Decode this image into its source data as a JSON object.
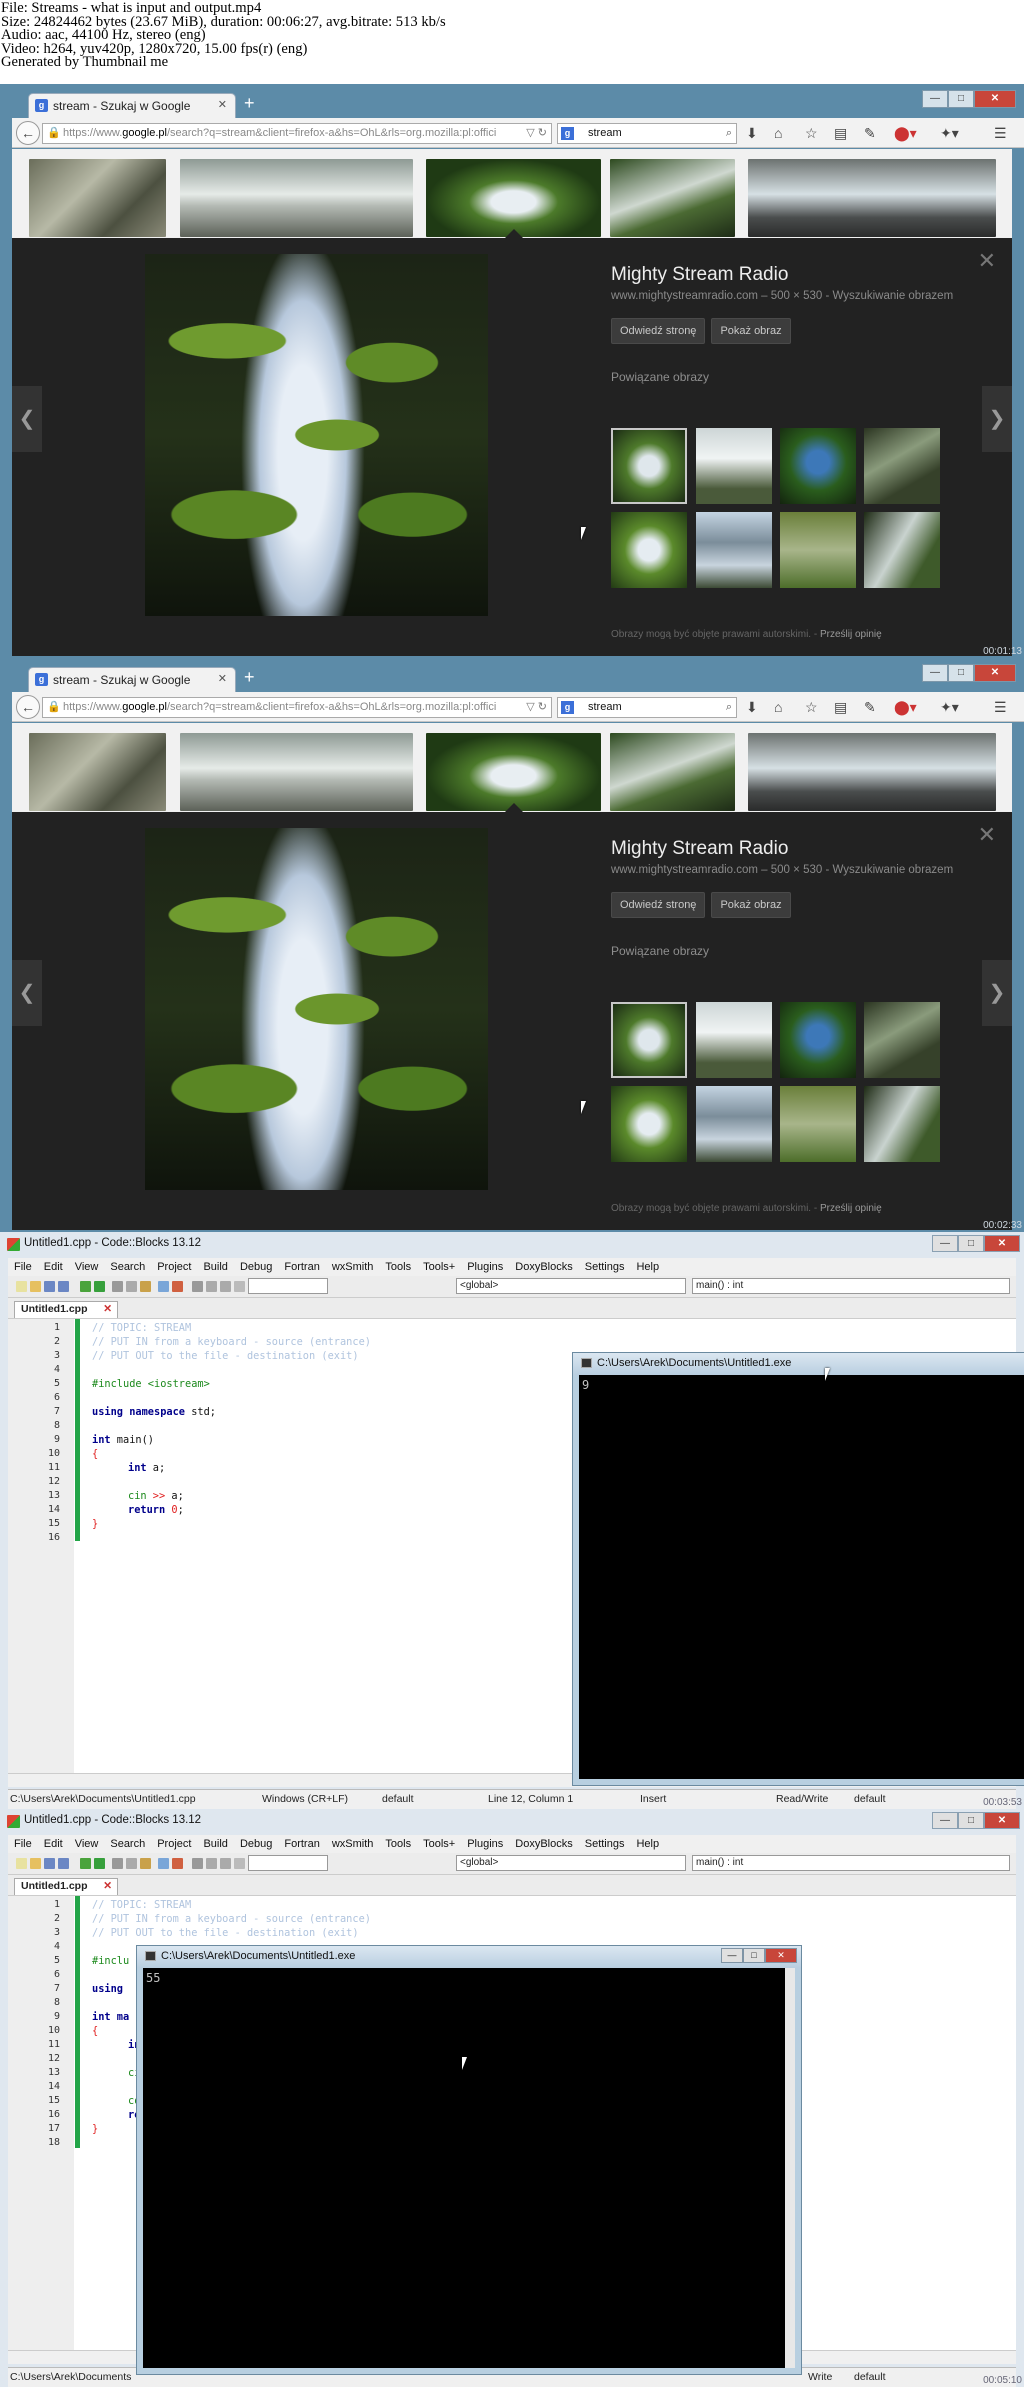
{
  "header": {
    "lines": [
      "File: Streams - what is input and output.mp4",
      "Size: 24824462 bytes (23.67 MiB), duration: 00:06:27, avg.bitrate: 513 kb/s",
      "Audio: aac, 44100 Hz, stereo (eng)",
      "Video: h264, yuv420p, 1280x720, 15.00 fps(r) (eng)",
      "Generated by Thumbnail me"
    ]
  },
  "frames": {
    "f1": {
      "timestamp": "00:01:13"
    },
    "f2": {
      "timestamp": "00:02:33"
    },
    "f3": {
      "timestamp": "00:03:53"
    },
    "f4": {
      "timestamp": "00:05:10"
    }
  },
  "browser": {
    "tab_title": "stream - Szukaj w Google",
    "url_prefix": "https://www.",
    "url_host": "google.pl",
    "url_rest": "/search?q=stream&client=firefox-a&hs=OhL&rls=org.mozilla:pl:offici",
    "search_value": "stream",
    "image_title": "Mighty Stream Radio",
    "image_meta": "www.mightystreamradio.com – 500 × 530 - Wyszukiwanie obrazem",
    "visit_page_btn": "Odwiedź stronę",
    "view_image_btn": "Pokaż obraz",
    "related_label": "Powiązane obrazy",
    "copyright_note": "Obrazy mogą być objęte prawami autorskimi.",
    "feedback_link": "Prześlij opinię"
  },
  "codeblocks": {
    "title": "Untitled1.cpp - Code::Blocks 13.12",
    "menu": [
      "File",
      "Edit",
      "View",
      "Search",
      "Project",
      "Build",
      "Debug",
      "Fortran",
      "wxSmith",
      "Tools",
      "Tools+",
      "Plugins",
      "DoxyBlocks",
      "Settings",
      "Help"
    ],
    "scope_combo": "<global>",
    "func_combo": "main() : int",
    "file_tab": "Untitled1.cpp",
    "line_numbers_a": [
      "1",
      "2",
      "3",
      "4",
      "5",
      "6",
      "7",
      "8",
      "9",
      "10",
      "11",
      "12",
      "13",
      "14",
      "15",
      "16"
    ],
    "line_numbers_b": [
      "1",
      "2",
      "3",
      "4",
      "5",
      "6",
      "7",
      "8",
      "9",
      "10",
      "11",
      "12",
      "13",
      "14",
      "15",
      "16",
      "17",
      "18"
    ],
    "code": {
      "c1": "// TOPIC: STREAM",
      "c2": "// PUT IN from a keyboard - source (entrance)",
      "c3": "// PUT OUT to the file - destination (exit)",
      "include": "#include <iostream>",
      "using_kw": "using namespace",
      "using_std": " std;",
      "main_kw": "int",
      "main_sig": " main()",
      "brace_open": "{",
      "decl_kw": "int",
      "decl_var": " a;",
      "cin": "cin",
      "cin_op": " >> ",
      "cin_var": "a;",
      "ret_kw": "return",
      "ret_val": "0",
      "ret_semi": ";",
      "brace_close": "}",
      "frag_incl": "#inclu",
      "frag_using": "using",
      "frag_int": "int ma",
      "frag_in": "in",
      "frag_ci": "ci",
      "frag_co": "co",
      "frag_re": "re"
    },
    "status_path": "C:\\Users\\Arek\\Documents\\Untitled1.cpp",
    "status_path_trunc": "C:\\Users\\Arek\\Documents",
    "status_eol": "Windows (CR+LF)",
    "status_enc": "default",
    "status_pos": "Line 12, Column 1",
    "status_mode": "Insert",
    "status_rw": "Read/Write",
    "status_rw_trunc": "Write",
    "status_lang": "default",
    "console_title": "C:\\Users\\Arek\\Documents\\Untitled1.exe",
    "console_text_a": "9",
    "console_text_b": "55"
  }
}
